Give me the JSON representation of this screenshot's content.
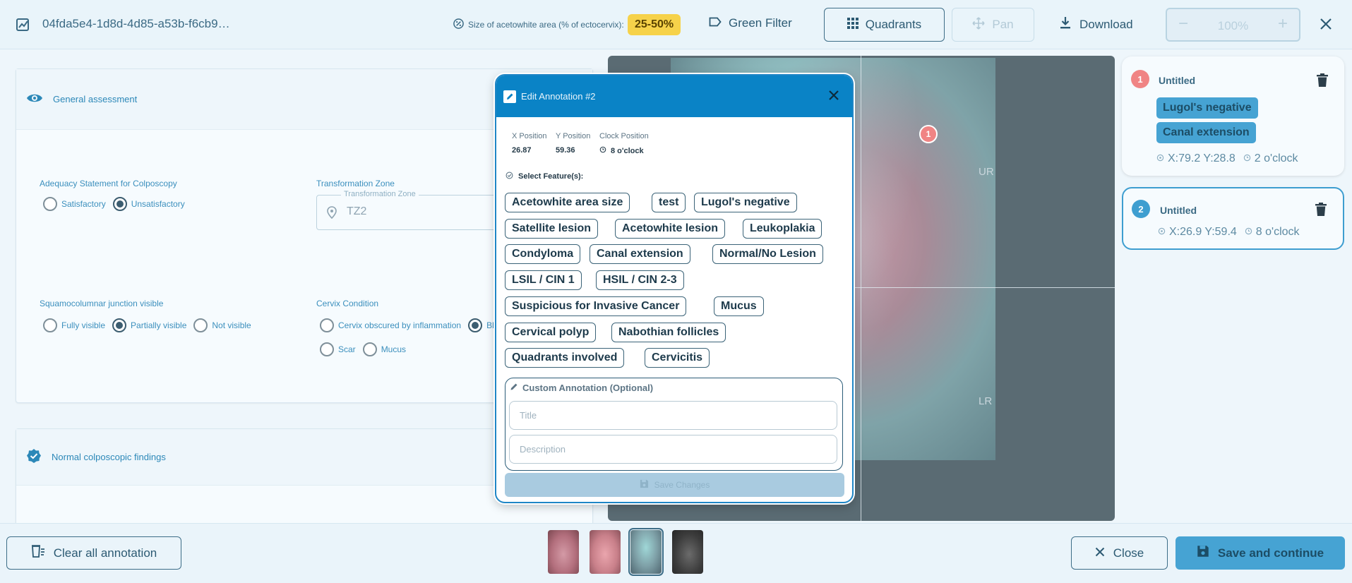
{
  "topbar": {
    "file_name": "04fda5e4-1d8d-4d85-a53b-f6cb9…",
    "size_label": "Size of acetowhite area (% of ectocervix):",
    "size_value": "25-50%",
    "green_filter": "Green Filter",
    "quadrants": "Quadrants",
    "pan": "Pan",
    "download": "Download",
    "zoom_minus": "−",
    "zoom_value": "100%",
    "zoom_plus": "+"
  },
  "left": {
    "general_title": "General assessment",
    "adequacy_label": "Adequacy Statement for Colposcopy",
    "adequacy_options": [
      "Satisfactory",
      "Unsatisfactory"
    ],
    "tz_label": "Transformation Zone",
    "tz_legend": "Transformation Zone",
    "tz_value": "TZ2",
    "scj_label": "Squamocolumnar junction visible",
    "scj_options": [
      "Fully visible",
      "Partially visible",
      "Not visible"
    ],
    "cervix_label": "Cervix Condition",
    "cervix_options": [
      "Cervix obscured by inflammation",
      "Bl",
      "Scar",
      "Mucus"
    ],
    "normal_title": "Normal colposcopic findings"
  },
  "viewer": {
    "quadrant_ur": "UR",
    "quadrant_lr": "LR",
    "pin1": "1"
  },
  "annotations": [
    {
      "num": "1",
      "title": "Untitled",
      "tags": [
        "Lugol's negative",
        "Canal extension"
      ],
      "coords": "X:79.2 Y:28.8",
      "clock": "2 o'clock"
    },
    {
      "num": "2",
      "title": "Untitled",
      "tags": [],
      "coords": "X:26.9 Y:59.4",
      "clock": "8 o'clock"
    }
  ],
  "dialog": {
    "title": "Edit Annotation #2",
    "x_label": "X Position",
    "x_value": "26.87",
    "y_label": "Y Position",
    "y_value": "59.36",
    "clock_label": "Clock Position",
    "clock_value": "8 o'clock",
    "select_title": "Select Feature(s):",
    "features": [
      "Acetowhite area size",
      "test",
      "Lugol's negative",
      "Satellite lesion",
      "Acetowhite lesion",
      "Leukoplakia",
      "Condyloma",
      "Canal extension",
      "Normal/No Lesion",
      "LSIL / CIN 1",
      "HSIL / CIN 2-3",
      "Suspicious for Invasive Cancer",
      "Mucus",
      "Cervical polyp",
      "Nabothian follicles",
      "Quadrants involved",
      "Cervicitis"
    ],
    "custom_title": "Custom Annotation (Optional)",
    "title_placeholder": "Title",
    "desc_placeholder": "Description",
    "save_label": "Save Changes"
  },
  "bottombar": {
    "clear": "Clear all annotation",
    "close": "Close",
    "save": "Save and continue"
  },
  "colors": {
    "accent": "#0a83c6",
    "badge": "#f6d24a",
    "pin_red": "#f08484",
    "chip_blue": "#46a3d3"
  }
}
